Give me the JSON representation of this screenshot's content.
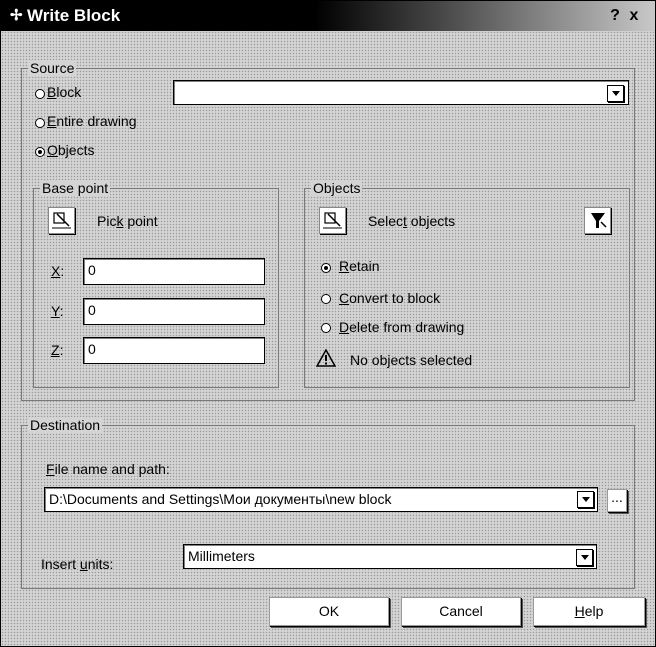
{
  "window": {
    "title": "Write Block",
    "title_icon": "block-icon",
    "help_button": "?",
    "close_button": "x"
  },
  "source": {
    "legend": "Source",
    "block_label_prefix": "",
    "block_label_mn": "B",
    "block_label_rest": "lock",
    "entire_label_mn": "E",
    "entire_label_rest": "ntire drawing",
    "objects_label_mn": "O",
    "objects_label_rest": "bjects",
    "selected": "Objects",
    "block_dropdown_value": ""
  },
  "base_point": {
    "legend": "Base point",
    "pick_label_a": "Pic",
    "pick_label_mn": "k",
    "pick_label_b": " point",
    "x_label": "X",
    "x_label_rest": ":",
    "y_label": "Y",
    "y_label_rest": ":",
    "z_label": "Z",
    "z_label_rest": ":",
    "x_value": "0",
    "y_value": "0",
    "z_value": "0"
  },
  "objects": {
    "legend": "Objects",
    "select_label_a": "Selec",
    "select_label_mn": "t",
    "select_label_b": " objects",
    "retain_mn": "R",
    "retain_rest": "etain",
    "convert_mn": "C",
    "convert_rest": "onvert to block",
    "delete_mn": "D",
    "delete_rest": "elete from drawing",
    "selected": "Retain",
    "status": "No objects selected"
  },
  "destination": {
    "legend": "Destination",
    "file_label_mn": "F",
    "file_label_rest": "ile name and path:",
    "file_value": "D:\\Documents and Settings\\Мои документы\\new block",
    "browse_label": "...",
    "units_label_a": "Insert ",
    "units_label_mn": "u",
    "units_label_b": "nits:",
    "units_value": "Millimeters"
  },
  "buttons": {
    "ok": "OK",
    "cancel": "Cancel",
    "help_mn": "H",
    "help_rest": "elp"
  },
  "icons": [
    "block-icon",
    "pick-point-icon",
    "select-objects-icon",
    "quick-select-icon",
    "warning-icon",
    "chevron-down-icon"
  ]
}
